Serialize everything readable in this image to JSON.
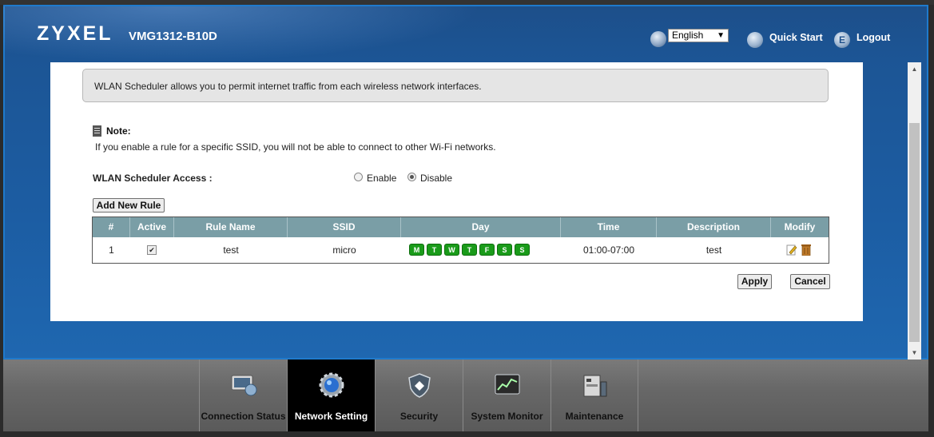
{
  "header": {
    "brand": "ZYXEL",
    "model": "VMG1312-B10D",
    "language": "English",
    "quick_start": "Quick Start",
    "logout": "Logout"
  },
  "content": {
    "info": "WLAN Scheduler allows you to permit internet traffic from each wireless network interfaces.",
    "note_title": "Note:",
    "note_text": "If you enable a rule for a specific SSID, you will not be able to connect to other Wi-Fi networks.",
    "access_label": "WLAN Scheduler Access :",
    "enable_label": "Enable",
    "disable_label": "Disable",
    "access_selected": "Disable",
    "add_rule": "Add New Rule",
    "apply": "Apply",
    "cancel": "Cancel"
  },
  "table": {
    "headers": [
      "#",
      "Active",
      "Rule Name",
      "SSID",
      "Day",
      "Time",
      "Description",
      "Modify"
    ],
    "rows": [
      {
        "index": "1",
        "active": true,
        "rule_name": "test",
        "ssid": "micro",
        "days": [
          "M",
          "T",
          "W",
          "T",
          "F",
          "S",
          "S"
        ],
        "time": "01:00-07:00",
        "description": "test"
      }
    ]
  },
  "nav": {
    "items": [
      {
        "label": "Connection Status",
        "icon": "monitor-globe-icon"
      },
      {
        "label": "Network Setting",
        "icon": "gear-icon",
        "active": true
      },
      {
        "label": "Security",
        "icon": "shield-icon"
      },
      {
        "label": "System Monitor",
        "icon": "chart-monitor-icon"
      },
      {
        "label": "Maintenance",
        "icon": "tools-icon"
      }
    ]
  },
  "colors": {
    "header_blue": "#1c5595",
    "table_header": "#7a9ea6",
    "day_green": "#1a9b1a",
    "nav_active": "#000000"
  }
}
